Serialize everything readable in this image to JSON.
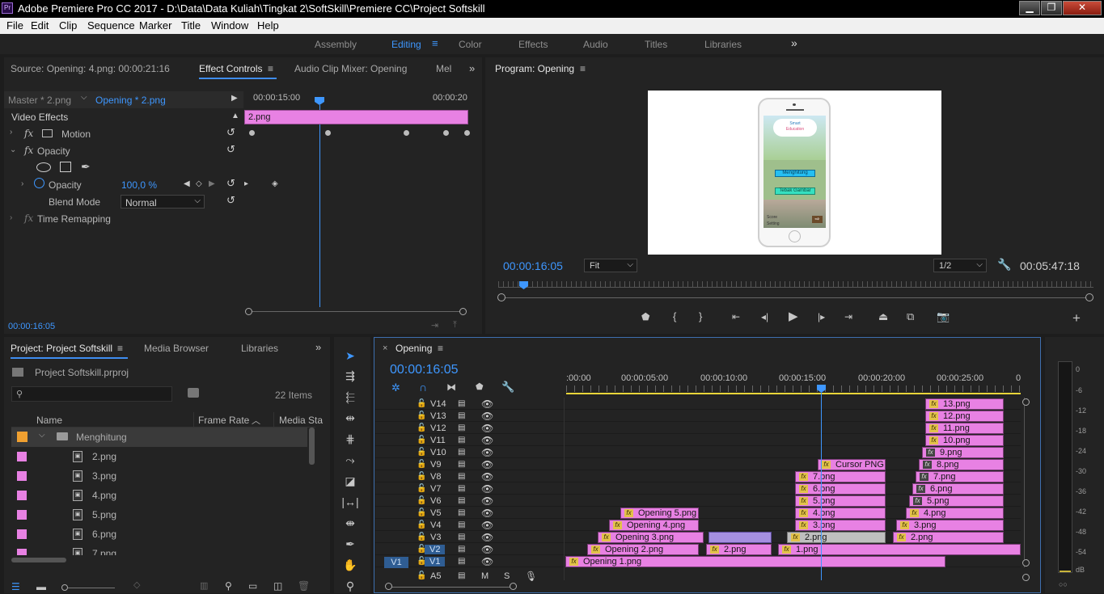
{
  "app": {
    "title": "Adobe Premiere Pro CC 2017 - D:\\Data\\Data Kuliah\\Tingkat 2\\SoftSkill\\Premiere CC\\Project Softskill",
    "logo": "Pr",
    "window_controls": {
      "minimize": "▁",
      "maximize": "❐",
      "close": "✕"
    }
  },
  "menu": [
    "File",
    "Edit",
    "Clip",
    "Sequence",
    "Marker",
    "Title",
    "Window",
    "Help"
  ],
  "workspaces": {
    "items": [
      "Assembly",
      "Editing",
      "Color",
      "Effects",
      "Audio",
      "Titles",
      "Libraries"
    ],
    "active": "Editing",
    "more": "»"
  },
  "source_panel": {
    "tabs": [
      "Source: Opening: 4.png: 00:00:21:16",
      "Effect Controls",
      "Audio Clip Mixer: Opening",
      "Mel"
    ],
    "active_tab": "Effect Controls",
    "master": "Master * 2.png",
    "clip": "Opening * 2.png",
    "ruler_start": "00:00:15:00",
    "ruler_end": "00:00:20",
    "clip_bar": "2.png",
    "section": "Video Effects",
    "effects": [
      {
        "name": "Motion",
        "fx": "fx"
      },
      {
        "name": "Opacity",
        "fx": "fx"
      },
      {
        "name": "Time Remapping",
        "fx": "fx"
      }
    ],
    "opacity_label": "Opacity",
    "opacity_value": "100,0 %",
    "blend_mode_label": "Blend Mode",
    "blend_mode_value": "Normal",
    "timecode": "00:00:16:05"
  },
  "program_panel": {
    "title": "Program: Opening",
    "timecode": "00:00:16:05",
    "fit": "Fit",
    "resolution": "1/2",
    "duration": "00:05:47:18",
    "preview": {
      "app_name_line1": "Smart",
      "app_name_line2": "Education",
      "button1": "Menghitung",
      "button2": "Tebak Gambar",
      "footer1": "Score",
      "footer2": "Setting"
    }
  },
  "project_panel": {
    "tabs": [
      "Project: Project Softskill",
      "Media Browser",
      "Libraries"
    ],
    "active_tab": "Project: Project Softskill",
    "file": "Project Softskill.prproj",
    "items_count": "22 Items",
    "columns": [
      "Name",
      "Frame Rate",
      "Media Sta"
    ],
    "bin": "Menghitung",
    "bin_color": "#f0a030",
    "rows": [
      "2.png",
      "3.png",
      "4.png",
      "5.png",
      "6.png",
      "7.png"
    ],
    "row_color": "#e881e3"
  },
  "timeline": {
    "tab": "Opening",
    "timecode": "00:00:16:05",
    "ruler": [
      ":00:00",
      "00:00:05:00",
      "00:00:10:00",
      "00:00:15:00",
      "00:00:20:00",
      "00:00:25:00",
      "0"
    ],
    "tracks": [
      "V14",
      "V13",
      "V12",
      "V11",
      "V10",
      "V9",
      "V8",
      "V7",
      "V6",
      "V5",
      "V4",
      "V3",
      "V2",
      "V1"
    ],
    "source_patch": "V1",
    "audio_track": "A5",
    "audio_m": "M",
    "audio_s": "S",
    "fx": "fx",
    "clips": {
      "v14": "13.png",
      "v13": "12.png",
      "v12": "11.png",
      "v11": "10.png",
      "v10": "9.png",
      "v9a": "Cursor PNG",
      "v9b": "8.png",
      "v8a": "7.png",
      "v8b": "7.png",
      "v7a": "6.png",
      "v7b": "6.png",
      "v6a": "5.png",
      "v6b": "5.png",
      "v5a": "Opening 5.png",
      "v5b": "4.png",
      "v5c": "4.png",
      "v4a": "Opening 4.png",
      "v4b": "3.png",
      "v4c": "3.png",
      "v3a": "Opening 3.png",
      "v3b": "2.png",
      "v3c": "2.png",
      "v2a": "Opening 2.png",
      "v2b": "2.png",
      "v2c": "1.png",
      "v1a": "Opening 1.png"
    }
  },
  "meter": {
    "ticks": [
      "0",
      "-6",
      "-12",
      "-18",
      "-24",
      "-30",
      "-36",
      "-42",
      "-48",
      "-54",
      "dB"
    ]
  }
}
